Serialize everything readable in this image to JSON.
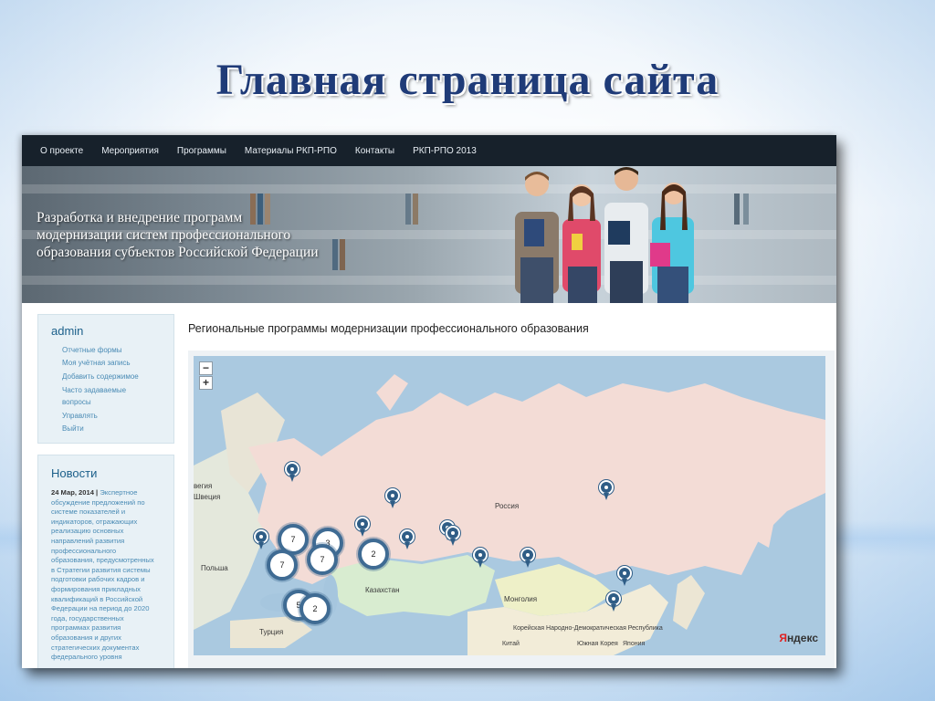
{
  "slide": {
    "title": "Главная страница сайта"
  },
  "nav": {
    "items": [
      "О проекте",
      "Мероприятия",
      "Программы",
      "Материалы РКП-РПО",
      "Контакты",
      "РКП-РПО 2013"
    ]
  },
  "banner": {
    "lines": [
      "Разработка и внедрение программ",
      "модернизации систем профессионального",
      "образования субъектов Российской Федерации"
    ]
  },
  "sidebar": {
    "user": "admin",
    "links": [
      "Отчетные формы",
      "Моя учётная запись",
      "Добавить содержимое",
      "Часто задаваемые",
      "вопросы",
      "Управлять",
      "Выйти"
    ],
    "news_title": "Новости",
    "news_date": "24 Мар, 2014 |",
    "news_text": "Экспертное обсуждение предложений по системе показателей и индикаторов, отражающих реализацию основных направлений развития профессионального образования, предусмотренных в Стратегии развития системы подготовки рабочих кадров и формирования прикладных квалификаций в Российской Федерации на период до 2020 года, государственных программах развития образования и других стратегических документах федерального уровня"
  },
  "main": {
    "heading": "Региональные программы модернизации профессионального образования"
  },
  "map": {
    "zoom_out": "−",
    "zoom_in": "+",
    "labels": {
      "russia": "Россия",
      "kazakhstan": "Казахстан",
      "mongolia": "Монголия",
      "korea_north": "Корейская Народно-Демократическая Республика",
      "china": "Китай",
      "korea_south": "Южная Корея",
      "japan": "Япония",
      "poland": "Польша",
      "turkey": "Турция",
      "sweden": "Швеция",
      "norway": "вегия"
    },
    "clusters": [
      "7",
      "3",
      "7",
      "7",
      "2",
      "5",
      "2"
    ],
    "logo_y": "Я",
    "logo_rest": "ндекс"
  },
  "colors": {
    "nav_bg": "#17212b",
    "accent": "#1b5f8a",
    "pin": "#2f5d86",
    "title": "#1f3b78"
  }
}
